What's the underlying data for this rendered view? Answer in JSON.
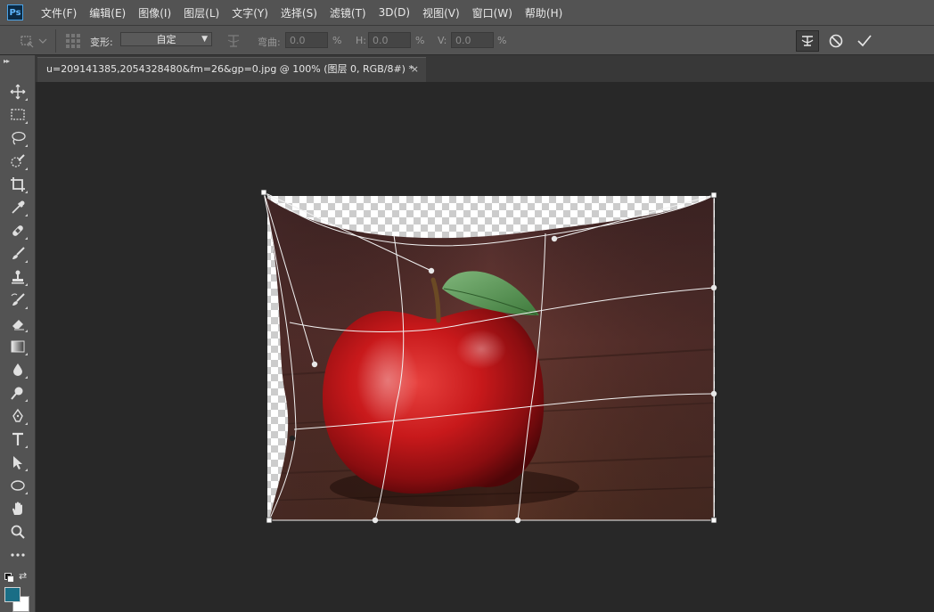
{
  "app": {
    "logo_text": "Ps"
  },
  "menu": [
    "文件(F)",
    "编辑(E)",
    "图像(I)",
    "图层(L)",
    "文字(Y)",
    "选择(S)",
    "滤镜(T)",
    "3D(D)",
    "视图(V)",
    "窗口(W)",
    "帮助(H)"
  ],
  "options": {
    "warp_label": "变形:",
    "warp_value": "自定",
    "bend_label": "弯曲:",
    "bend_value": "0.0",
    "h_label": "H:",
    "h_value": "0.0",
    "v_label": "V:",
    "v_value": "0.0",
    "percent": "%",
    "icons": {
      "toggle_warp": "warp-mode-icon",
      "cancel": "cancel-icon",
      "commit": "checkmark-icon"
    }
  },
  "document": {
    "tab_title": "u=209141385,2054328480&fm=26&gp=0.jpg @ 100% (图层 0, RGB/8#) *",
    "close_symbol": "×"
  },
  "toolbar": {
    "tools": [
      "move-tool",
      "marquee-tool",
      "lasso-tool",
      "quick-select-tool",
      "crop-tool",
      "eyedropper-tool",
      "healing-brush-tool",
      "brush-tool",
      "clone-stamp-tool",
      "history-brush-tool",
      "eraser-tool",
      "gradient-tool",
      "blur-tool",
      "dodge-tool",
      "pen-tool",
      "type-tool",
      "path-select-tool",
      "ellipse-tool",
      "hand-tool",
      "zoom-tool",
      "more-tools"
    ],
    "foreground_color": "#1a6e86",
    "background_color": "#ffffff"
  }
}
